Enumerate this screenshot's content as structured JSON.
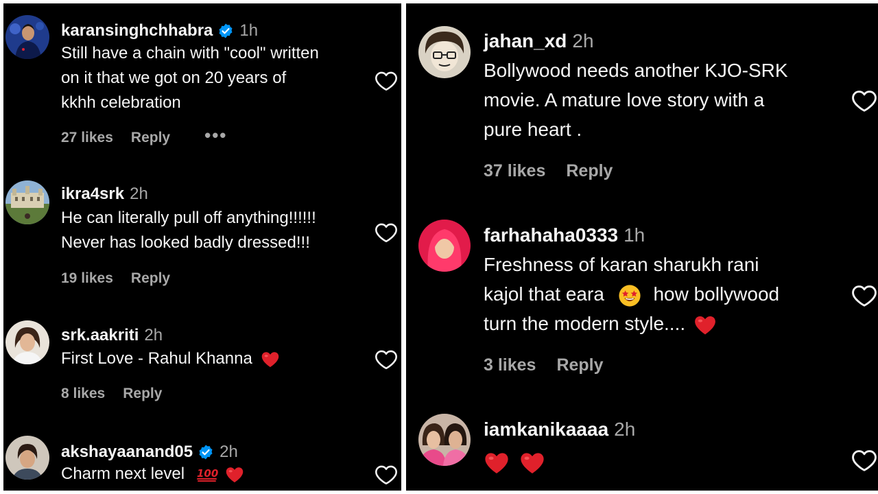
{
  "left_panel": {
    "comments": [
      {
        "username": "karansinghchhabra",
        "verified": true,
        "time": "1h",
        "lines": [
          "Still have a chain with \"cool\" written",
          "on it that we got on 20 years of",
          "kkhh celebration"
        ],
        "likes": "27 likes",
        "reply": "Reply",
        "more": "•••"
      },
      {
        "username": "ikra4srk",
        "verified": false,
        "time": "2h",
        "lines": [
          "He can literally pull off anything!!!!!!",
          "Never has looked badly dressed!!!"
        ],
        "likes": "19 likes",
        "reply": "Reply"
      },
      {
        "username": "srk.aakriti",
        "verified": false,
        "time": "2h",
        "lines": [
          "First Love - Rahul Khanna"
        ],
        "likes": "8 likes",
        "reply": "Reply"
      },
      {
        "username": "akshayaanand05",
        "verified": true,
        "time": "2h",
        "lines": [
          "Charm next level"
        ]
      }
    ]
  },
  "right_panel": {
    "comments": [
      {
        "username": "jahan_xd",
        "time": "2h",
        "lines": [
          "Bollywood needs another KJO-SRK",
          "movie. A mature love story with a",
          "pure heart ."
        ],
        "likes": "37 likes",
        "reply": "Reply"
      },
      {
        "username": "farhahaha0333",
        "time": "1h",
        "lines": [
          "Freshness of karan sharukh rani",
          "kajol that eara",
          "how bollywood",
          "turn the modern style...."
        ],
        "likes": "3 likes",
        "reply": "Reply"
      },
      {
        "username": "iamkanikaaaa",
        "time": "2h",
        "lines": []
      }
    ]
  },
  "icons": {
    "like": "heart-outline-icon",
    "verified": "verified-badge-icon",
    "red_heart": "red-heart-emoji",
    "hundred": "hundred-points-emoji",
    "star_eyes": "star-struck-emoji"
  },
  "colors": {
    "background": "#000000",
    "text": "#f5f5f5",
    "secondary": "#a8a8a8",
    "verified": "#0095f6",
    "heart_emoji": "#e0212b"
  }
}
